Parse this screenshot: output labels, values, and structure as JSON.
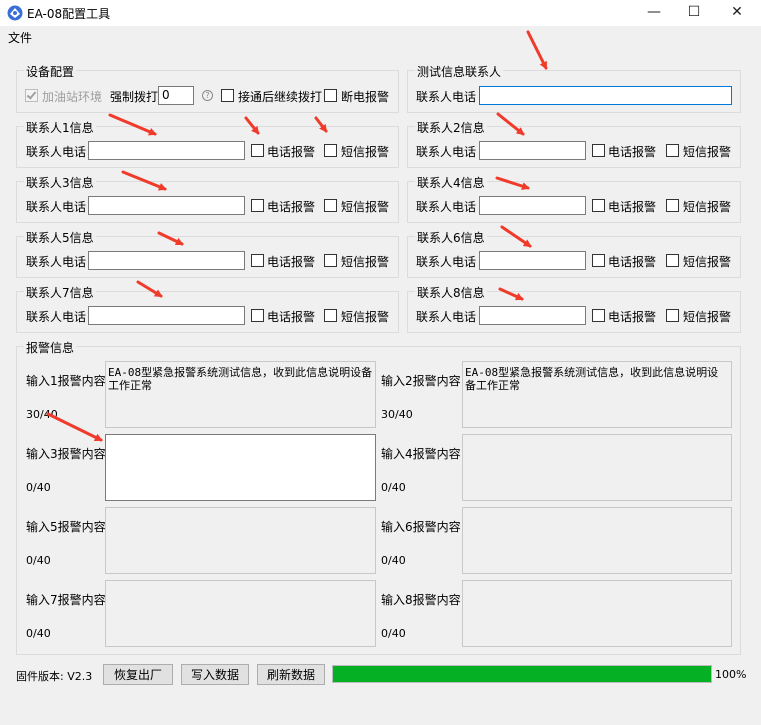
{
  "window": {
    "title": "EA-08配置工具",
    "minimize": "—",
    "maximize": "☐",
    "close": "✕"
  },
  "menu": {
    "file": "文件"
  },
  "device": {
    "title": "设备配置",
    "gas_env": "加油站环境",
    "gas_env_checked": true,
    "force_label": "强制拨打",
    "force_value": "0",
    "help": "?",
    "continue_dial": "接通后继续拨打",
    "power_off_alarm": "断电报警"
  },
  "test_contact": {
    "title": "测试信息联系人",
    "phone_label": "联系人电话",
    "phone_value": ""
  },
  "contacts": [
    {
      "title": "联系人1信息",
      "phone_label": "联系人电话",
      "phone_value": "",
      "call": "电话报警",
      "sms": "短信报警"
    },
    {
      "title": "联系人2信息",
      "phone_label": "联系人电话",
      "phone_value": "",
      "call": "电话报警",
      "sms": "短信报警"
    },
    {
      "title": "联系人3信息",
      "phone_label": "联系人电话",
      "phone_value": "",
      "call": "电话报警",
      "sms": "短信报警"
    },
    {
      "title": "联系人4信息",
      "phone_label": "联系人电话",
      "phone_value": "",
      "call": "电话报警",
      "sms": "短信报警"
    },
    {
      "title": "联系人5信息",
      "phone_label": "联系人电话",
      "phone_value": "",
      "call": "电话报警",
      "sms": "短信报警"
    },
    {
      "title": "联系人6信息",
      "phone_label": "联系人电话",
      "phone_value": "",
      "call": "电话报警",
      "sms": "短信报警"
    },
    {
      "title": "联系人7信息",
      "phone_label": "联系人电话",
      "phone_value": "",
      "call": "电话报警",
      "sms": "短信报警"
    },
    {
      "title": "联系人8信息",
      "phone_label": "联系人电话",
      "phone_value": "",
      "call": "电话报警",
      "sms": "短信报警"
    }
  ],
  "alarm": {
    "title": "报警信息",
    "inputs": [
      {
        "label": "输入1报警内容",
        "content": "EA-08型紧急报警系统测试信息，收到此信息说明设备工作正常",
        "count": "30/40"
      },
      {
        "label": "输入2报警内容",
        "content": "EA-08型紧急报警系统测试信息，收到此信息说明设备工作正常",
        "count": "30/40"
      },
      {
        "label": "输入3报警内容",
        "content": "",
        "count": "0/40"
      },
      {
        "label": "输入4报警内容",
        "content": "",
        "count": "0/40"
      },
      {
        "label": "输入5报警内容",
        "content": "",
        "count": "0/40"
      },
      {
        "label": "输入6报警内容",
        "content": "",
        "count": "0/40"
      },
      {
        "label": "输入7报警内容",
        "content": "",
        "count": "0/40"
      },
      {
        "label": "输入8报警内容",
        "content": "",
        "count": "0/40"
      }
    ]
  },
  "footer": {
    "firmware": "固件版本: V2.3",
    "factory_reset": "恢复出厂",
    "write_data": "写入数据",
    "refresh_data": "刷新数据",
    "progress_percent": 100,
    "progress_text": "100%"
  },
  "colors": {
    "annotation_arrow": "#f03a2a",
    "progress": "#06b025",
    "focus": "#0078d7"
  }
}
